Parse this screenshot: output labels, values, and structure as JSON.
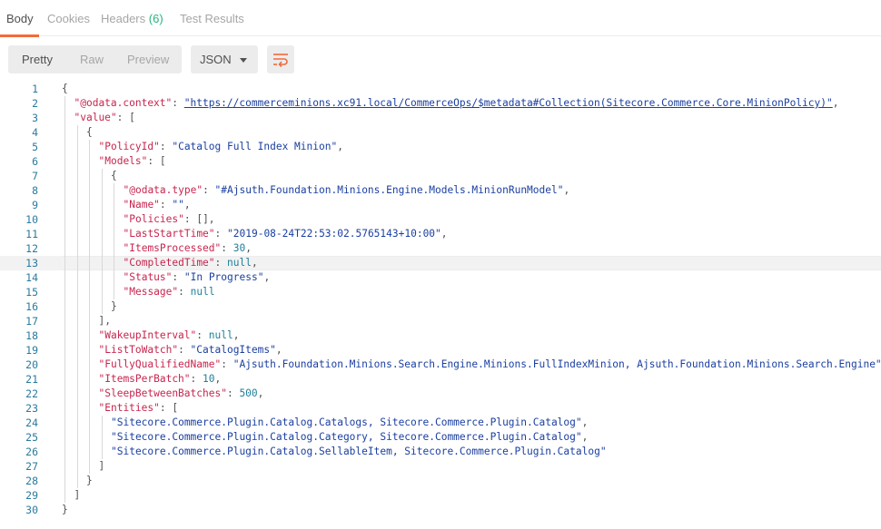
{
  "tabs": [
    {
      "label": "Body",
      "active": true
    },
    {
      "label": "Cookies",
      "active": false
    },
    {
      "label": "Headers",
      "count": "(6)",
      "active": false
    },
    {
      "label": "Test Results",
      "active": false
    }
  ],
  "toolbar": {
    "view_modes": [
      "Pretty",
      "Raw",
      "Preview"
    ],
    "active_view": "Pretty",
    "format_value": "JSON",
    "wrap_icon": "wrap-lines-icon",
    "accent_color": "#f26b3a"
  },
  "editor": {
    "active_line": 13,
    "lines": [
      {
        "n": "1",
        "indent": 0,
        "parts": [
          [
            "p",
            "{"
          ]
        ]
      },
      {
        "n": "2",
        "indent": 1,
        "parts": [
          [
            "k",
            "\"@odata.context\""
          ],
          [
            "p",
            ": "
          ],
          [
            "url",
            "\"https://commerceminions.xc91.local/CommerceOps/$metadata#Collection(Sitecore.Commerce.Core.MinionPolicy)\""
          ],
          [
            "p",
            ","
          ]
        ]
      },
      {
        "n": "3",
        "indent": 1,
        "parts": [
          [
            "k",
            "\"value\""
          ],
          [
            "p",
            ": ["
          ]
        ]
      },
      {
        "n": "4",
        "indent": 2,
        "parts": [
          [
            "p",
            "{"
          ]
        ]
      },
      {
        "n": "5",
        "indent": 3,
        "parts": [
          [
            "k",
            "\"PolicyId\""
          ],
          [
            "p",
            ": "
          ],
          [
            "s",
            "\"Catalog Full Index Minion\""
          ],
          [
            "p",
            ","
          ]
        ]
      },
      {
        "n": "6",
        "indent": 3,
        "parts": [
          [
            "k",
            "\"Models\""
          ],
          [
            "p",
            ": ["
          ]
        ]
      },
      {
        "n": "7",
        "indent": 4,
        "parts": [
          [
            "p",
            "{"
          ]
        ]
      },
      {
        "n": "8",
        "indent": 5,
        "parts": [
          [
            "k",
            "\"@odata.type\""
          ],
          [
            "p",
            ": "
          ],
          [
            "s",
            "\"#Ajsuth.Foundation.Minions.Engine.Models.MinionRunModel\""
          ],
          [
            "p",
            ","
          ]
        ]
      },
      {
        "n": "9",
        "indent": 5,
        "parts": [
          [
            "k",
            "\"Name\""
          ],
          [
            "p",
            ": "
          ],
          [
            "s",
            "\"\""
          ],
          [
            "p",
            ","
          ]
        ]
      },
      {
        "n": "10",
        "indent": 5,
        "parts": [
          [
            "k",
            "\"Policies\""
          ],
          [
            "p",
            ": [],"
          ]
        ]
      },
      {
        "n": "11",
        "indent": 5,
        "parts": [
          [
            "k",
            "\"LastStartTime\""
          ],
          [
            "p",
            ": "
          ],
          [
            "s",
            "\"2019-08-24T22:53:02.5765143+10:00\""
          ],
          [
            "p",
            ","
          ]
        ]
      },
      {
        "n": "12",
        "indent": 5,
        "parts": [
          [
            "k",
            "\"ItemsProcessed\""
          ],
          [
            "p",
            ": "
          ],
          [
            "n",
            "30"
          ],
          [
            "p",
            ","
          ]
        ]
      },
      {
        "n": "13",
        "indent": 5,
        "parts": [
          [
            "k",
            "\"CompletedTime\""
          ],
          [
            "p",
            ": "
          ],
          [
            "n",
            "null"
          ],
          [
            "p",
            ","
          ]
        ]
      },
      {
        "n": "14",
        "indent": 5,
        "parts": [
          [
            "k",
            "\"Status\""
          ],
          [
            "p",
            ": "
          ],
          [
            "s",
            "\"In Progress\""
          ],
          [
            "p",
            ","
          ]
        ]
      },
      {
        "n": "15",
        "indent": 5,
        "parts": [
          [
            "k",
            "\"Message\""
          ],
          [
            "p",
            ": "
          ],
          [
            "n",
            "null"
          ]
        ]
      },
      {
        "n": "16",
        "indent": 4,
        "parts": [
          [
            "p",
            "}"
          ]
        ]
      },
      {
        "n": "17",
        "indent": 3,
        "parts": [
          [
            "p",
            "],"
          ]
        ]
      },
      {
        "n": "18",
        "indent": 3,
        "parts": [
          [
            "k",
            "\"WakeupInterval\""
          ],
          [
            "p",
            ": "
          ],
          [
            "n",
            "null"
          ],
          [
            "p",
            ","
          ]
        ]
      },
      {
        "n": "19",
        "indent": 3,
        "parts": [
          [
            "k",
            "\"ListToWatch\""
          ],
          [
            "p",
            ": "
          ],
          [
            "s",
            "\"CatalogItems\""
          ],
          [
            "p",
            ","
          ]
        ]
      },
      {
        "n": "20",
        "indent": 3,
        "parts": [
          [
            "k",
            "\"FullyQualifiedName\""
          ],
          [
            "p",
            ": "
          ],
          [
            "s",
            "\"Ajsuth.Foundation.Minions.Search.Engine.Minions.FullIndexMinion, Ajsuth.Foundation.Minions.Search.Engine\""
          ],
          [
            "p",
            ","
          ]
        ]
      },
      {
        "n": "21",
        "indent": 3,
        "parts": [
          [
            "k",
            "\"ItemsPerBatch\""
          ],
          [
            "p",
            ": "
          ],
          [
            "n",
            "10"
          ],
          [
            "p",
            ","
          ]
        ]
      },
      {
        "n": "22",
        "indent": 3,
        "parts": [
          [
            "k",
            "\"SleepBetweenBatches\""
          ],
          [
            "p",
            ": "
          ],
          [
            "n",
            "500"
          ],
          [
            "p",
            ","
          ]
        ]
      },
      {
        "n": "23",
        "indent": 3,
        "parts": [
          [
            "k",
            "\"Entities\""
          ],
          [
            "p",
            ": ["
          ]
        ]
      },
      {
        "n": "24",
        "indent": 4,
        "parts": [
          [
            "s",
            "\"Sitecore.Commerce.Plugin.Catalog.Catalogs, Sitecore.Commerce.Plugin.Catalog\""
          ],
          [
            "p",
            ","
          ]
        ]
      },
      {
        "n": "25",
        "indent": 4,
        "parts": [
          [
            "s",
            "\"Sitecore.Commerce.Plugin.Catalog.Category, Sitecore.Commerce.Plugin.Catalog\""
          ],
          [
            "p",
            ","
          ]
        ]
      },
      {
        "n": "26",
        "indent": 4,
        "parts": [
          [
            "s",
            "\"Sitecore.Commerce.Plugin.Catalog.SellableItem, Sitecore.Commerce.Plugin.Catalog\""
          ]
        ]
      },
      {
        "n": "27",
        "indent": 3,
        "parts": [
          [
            "p",
            "]"
          ]
        ]
      },
      {
        "n": "28",
        "indent": 2,
        "parts": [
          [
            "p",
            "}"
          ]
        ]
      },
      {
        "n": "29",
        "indent": 1,
        "parts": [
          [
            "p",
            "]"
          ]
        ]
      },
      {
        "n": "30",
        "indent": 0,
        "parts": [
          [
            "p",
            "}"
          ]
        ]
      }
    ]
  }
}
